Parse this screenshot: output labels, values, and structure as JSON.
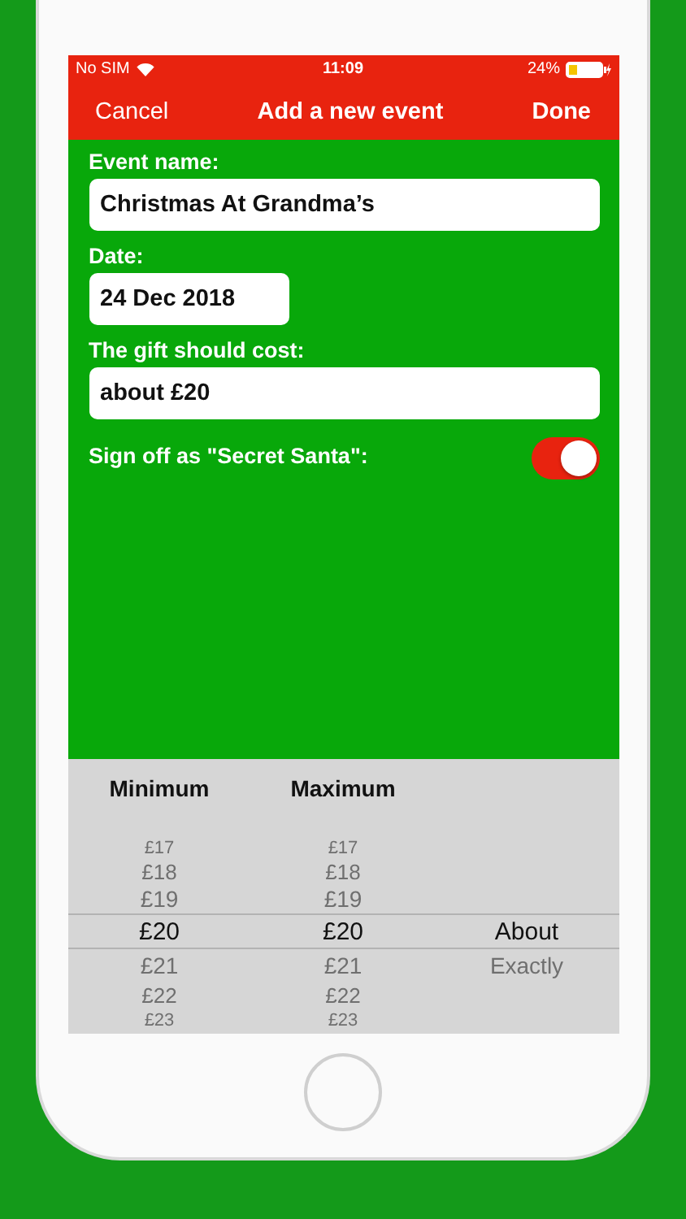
{
  "status_bar": {
    "carrier": "No SIM",
    "time": "11:09",
    "battery": "24%"
  },
  "nav_bar": {
    "cancel": "Cancel",
    "title": "Add a new event",
    "done": "Done"
  },
  "form": {
    "fields": [
      {
        "label": "Event name:",
        "value": "Christmas At Grandma’s",
        "kind": "text"
      },
      {
        "label": "Date:",
        "value": "24 Dec 2018",
        "kind": "date"
      },
      {
        "label": "The gift should cost:",
        "value": "about £20",
        "kind": "text"
      }
    ],
    "toggle": {
      "label": "Sign off as \"Secret Santa\":",
      "on": true
    }
  },
  "picker": {
    "columns": [
      {
        "header": "Minimum",
        "items": [
          {
            "text": "£17",
            "selected": false
          },
          {
            "text": "£18",
            "selected": false
          },
          {
            "text": "£19",
            "selected": false
          },
          {
            "text": "£20",
            "selected": true
          },
          {
            "text": "£21",
            "selected": false
          },
          {
            "text": "£22",
            "selected": false
          },
          {
            "text": "£23",
            "selected": false
          }
        ]
      },
      {
        "header": "Maximum",
        "items": [
          {
            "text": "£17",
            "selected": false
          },
          {
            "text": "£18",
            "selected": false
          },
          {
            "text": "£19",
            "selected": false
          },
          {
            "text": "£20",
            "selected": true
          },
          {
            "text": "£21",
            "selected": false
          },
          {
            "text": "£22",
            "selected": false
          },
          {
            "text": "£23",
            "selected": false
          }
        ]
      },
      {
        "items": [
          {
            "text": "About",
            "selected": true
          },
          {
            "text": "Exactly",
            "selected": false
          }
        ]
      }
    ]
  }
}
